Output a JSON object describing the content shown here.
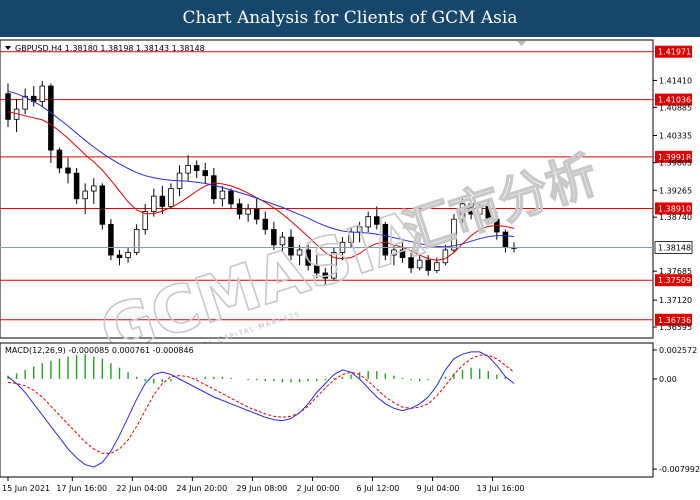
{
  "header": {
    "title": "Chart Analysis for Clients of GCM Asia"
  },
  "main_chart": {
    "symbol_line": "GBPUSD,H4  1.38180 1.38198 1.38143 1.38148",
    "current_price": "1.38148"
  },
  "macd_panel": {
    "label": "MACD(12,26,9) -0.000085 0.000761 -0.000846"
  },
  "watermark": {
    "text": "GCMASIA",
    "subtext": "GLOBAL CAPITAL MARKETS",
    "chinese": "汇市分析"
  },
  "colors": {
    "header_bg": "#16476b",
    "level_line": "#e00000",
    "ma_fast": "#e00000",
    "ma_slow": "#2a2ae0",
    "macd_hist": "#1fa21f",
    "signal_line": "#e00000",
    "macd_line": "#2a2ae0"
  },
  "chart_data": [
    {
      "type": "candlestick",
      "title": "",
      "series": [
        {
          "kind": "candles",
          "values": [
            [
              1.4115,
              1.4135,
              1.405,
              1.4065
            ],
            [
              1.4065,
              1.4105,
              1.404,
              1.4085
            ],
            [
              1.4085,
              1.4125,
              1.4075,
              1.411
            ],
            [
              1.411,
              1.413,
              1.409,
              1.41
            ],
            [
              1.41,
              1.414,
              1.409,
              1.413
            ],
            [
              1.413,
              1.4135,
              1.398,
              1.4005
            ],
            [
              1.4005,
              1.401,
              1.396,
              1.397
            ],
            [
              1.397,
              1.399,
              1.394,
              1.396
            ],
            [
              1.396,
              1.397,
              1.39,
              1.391
            ],
            [
              1.391,
              1.394,
              1.388,
              1.3925
            ],
            [
              1.3925,
              1.395,
              1.39,
              1.3935
            ],
            [
              1.3935,
              1.394,
              1.385,
              1.386
            ],
            [
              1.386,
              1.387,
              1.379,
              1.38
            ],
            [
              1.38,
              1.381,
              1.378,
              1.3795
            ],
            [
              1.3795,
              1.3815,
              1.3785,
              1.3805
            ],
            [
              1.3805,
              1.386,
              1.38,
              1.385
            ],
            [
              1.385,
              1.39,
              1.384,
              1.3885
            ],
            [
              1.3885,
              1.393,
              1.3875,
              1.3915
            ],
            [
              1.3915,
              1.3935,
              1.388,
              1.3895
            ],
            [
              1.3895,
              1.394,
              1.389,
              1.393
            ],
            [
              1.393,
              1.3975,
              1.3915,
              1.396
            ],
            [
              1.396,
              1.3995,
              1.3945,
              1.3975
            ],
            [
              1.3975,
              1.3985,
              1.395,
              1.3965
            ],
            [
              1.3965,
              1.398,
              1.394,
              1.3955
            ],
            [
              1.3955,
              1.397,
              1.39,
              1.391
            ],
            [
              1.391,
              1.3935,
              1.3895,
              1.3925
            ],
            [
              1.3925,
              1.393,
              1.389,
              1.39
            ],
            [
              1.39,
              1.391,
              1.387,
              1.388
            ],
            [
              1.388,
              1.39,
              1.3865,
              1.389
            ],
            [
              1.389,
              1.391,
              1.386,
              1.387
            ],
            [
              1.387,
              1.3885,
              1.384,
              1.385
            ],
            [
              1.385,
              1.3865,
              1.381,
              1.382
            ],
            [
              1.382,
              1.3845,
              1.3805,
              1.3835
            ],
            [
              1.3835,
              1.385,
              1.379,
              1.38
            ],
            [
              1.38,
              1.382,
              1.378,
              1.381
            ],
            [
              1.381,
              1.3825,
              1.377,
              1.378
            ],
            [
              1.378,
              1.38,
              1.3755,
              1.3765
            ],
            [
              1.3765,
              1.3775,
              1.374,
              1.3755
            ],
            [
              1.3755,
              1.3815,
              1.375,
              1.3805
            ],
            [
              1.3805,
              1.3835,
              1.379,
              1.3825
            ],
            [
              1.3825,
              1.3855,
              1.3815,
              1.3845
            ],
            [
              1.3845,
              1.3865,
              1.3825,
              1.3855
            ],
            [
              1.3855,
              1.3885,
              1.3845,
              1.3875
            ],
            [
              1.3875,
              1.3895,
              1.385,
              1.386
            ],
            [
              1.386,
              1.3865,
              1.379,
              1.38
            ],
            [
              1.38,
              1.382,
              1.378,
              1.381
            ],
            [
              1.381,
              1.3825,
              1.3785,
              1.3795
            ],
            [
              1.3795,
              1.381,
              1.3765,
              1.3775
            ],
            [
              1.3775,
              1.38,
              1.377,
              1.379
            ],
            [
              1.379,
              1.38,
              1.376,
              1.377
            ],
            [
              1.377,
              1.3795,
              1.3765,
              1.3785
            ],
            [
              1.3785,
              1.382,
              1.378,
              1.381
            ],
            [
              1.381,
              1.388,
              1.3805,
              1.387
            ],
            [
              1.387,
              1.391,
              1.386,
              1.39
            ],
            [
              1.39,
              1.3905,
              1.387,
              1.388
            ],
            [
              1.388,
              1.3905,
              1.3875,
              1.3895
            ],
            [
              1.3895,
              1.3905,
              1.386,
              1.387
            ],
            [
              1.387,
              1.3885,
              1.383,
              1.3845
            ],
            [
              1.3845,
              1.385,
              1.3805,
              1.3815
            ],
            [
              1.3815,
              1.3825,
              1.3805,
              1.3815
            ]
          ]
        },
        {
          "kind": "ma_fast",
          "values": [
            1.408,
            1.4076,
            1.4072,
            1.4068,
            1.4064,
            1.4055,
            1.4042,
            1.4028,
            1.4012,
            1.3996,
            1.3982,
            1.3966,
            1.3946,
            1.3925,
            1.3904,
            1.3888,
            1.3881,
            1.3881,
            1.3886,
            1.3893,
            1.3902,
            1.3913,
            1.3925,
            1.3935,
            1.3941,
            1.3939,
            1.3935,
            1.3929,
            1.3921,
            1.3912,
            1.3903,
            1.3892,
            1.388,
            1.3866,
            1.3851,
            1.3836,
            1.382,
            1.3805,
            1.3795,
            1.3793,
            1.3795,
            1.3803,
            1.3815,
            1.3823,
            1.3825,
            1.382,
            1.3815,
            1.3808,
            1.38,
            1.3793,
            1.379,
            1.3793,
            1.3805,
            1.3822,
            1.3838,
            1.385,
            1.3856,
            1.3858,
            1.3856,
            1.3852
          ]
        },
        {
          "kind": "ma_slow",
          "values": [
            1.412,
            1.4115,
            1.4108,
            1.41,
            1.409,
            1.4078,
            1.4065,
            1.4052,
            1.4038,
            1.4024,
            1.4011,
            1.3999,
            1.3988,
            1.3978,
            1.3969,
            1.3961,
            1.3955,
            1.3951,
            1.3948,
            1.3946,
            1.3945,
            1.3944,
            1.3942,
            1.394,
            1.3936,
            1.3932,
            1.3927,
            1.3922,
            1.3917,
            1.3911,
            1.3905,
            1.3899,
            1.3893,
            1.3886,
            1.3879,
            1.3872,
            1.3864,
            1.3857,
            1.3851,
            1.3847,
            1.3845,
            1.3844,
            1.3843,
            1.3841,
            1.3838,
            1.3834,
            1.383,
            1.3826,
            1.3822,
            1.3819,
            1.3817,
            1.3816,
            1.3818,
            1.3822,
            1.3827,
            1.3832,
            1.3836,
            1.3838,
            1.3838,
            1.3836
          ]
        }
      ],
      "levels": [
        "1.41971",
        "1.41036",
        "1.39918",
        "1.38910",
        "1.37509",
        "1.36736"
      ],
      "y_ticks": [
        "1.41410",
        "1.40885",
        "1.40335",
        "1.39805",
        "1.39265",
        "1.38740",
        "1.37685",
        "1.37120",
        "1.36595"
      ],
      "ylim": [
        1.364,
        1.4218
      ]
    },
    {
      "type": "macd",
      "title": "",
      "series": [
        {
          "kind": "histogram",
          "values": [
            0.0003,
            0.0005,
            0.0008,
            0.0011,
            0.0014,
            0.0016,
            0.0018,
            0.002,
            0.0021,
            0.0022,
            0.002,
            0.0018,
            0.0014,
            0.001,
            0.0006,
            0.0002,
            -0.0002,
            -0.0004,
            -0.0003,
            -0.0002,
            -0.0001,
            0.0,
            0.0001,
            0.0002,
            0.0002,
            0.0002,
            0.0001,
            0.0,
            -0.0001,
            -0.0001,
            -0.0002,
            -0.0002,
            -0.0003,
            -0.0003,
            -0.0003,
            -0.0002,
            -0.0002,
            -0.0001,
            0.0001,
            0.0002,
            0.0004,
            0.0006,
            0.0007,
            0.0007,
            0.0005,
            0.0003,
            0.0001,
            -0.0001,
            -0.0002,
            -0.0001,
            0.0,
            0.0002,
            0.0005,
            0.0008,
            0.001,
            0.0009,
            0.0007,
            0.0004,
            0.0002,
            0.0
          ]
        },
        {
          "kind": "macd_line",
          "values": [
            0.0002,
            -0.0004,
            -0.0012,
            -0.0022,
            -0.0032,
            -0.0042,
            -0.0052,
            -0.0062,
            -0.007,
            -0.0076,
            -0.0078,
            -0.0074,
            -0.0064,
            -0.005,
            -0.0034,
            -0.0018,
            -0.0004,
            0.0004,
            0.0006,
            0.0004,
            0.0,
            -0.0004,
            -0.0008,
            -0.0012,
            -0.0016,
            -0.0019,
            -0.0022,
            -0.0025,
            -0.0028,
            -0.0031,
            -0.0034,
            -0.0036,
            -0.0037,
            -0.0035,
            -0.003,
            -0.0022,
            -0.0012,
            -0.0004,
            0.0004,
            0.0008,
            0.0006,
            0.0,
            -0.0008,
            -0.0016,
            -0.0022,
            -0.0026,
            -0.0028,
            -0.0026,
            -0.0022,
            -0.0016,
            -0.0006,
            0.0008,
            0.0018,
            0.0022,
            0.0024,
            0.0024,
            0.002,
            0.0012,
            0.0002,
            -0.0004
          ]
        },
        {
          "kind": "signal_line",
          "values": [
            -0.0003,
            -0.0004,
            -0.0006,
            -0.001,
            -0.0016,
            -0.0024,
            -0.0032,
            -0.004,
            -0.0048,
            -0.0056,
            -0.0062,
            -0.0066,
            -0.0066,
            -0.0062,
            -0.0054,
            -0.0042,
            -0.0028,
            -0.0014,
            -0.0004,
            0.0002,
            0.0003,
            0.0002,
            -0.0001,
            -0.0005,
            -0.0009,
            -0.0013,
            -0.0017,
            -0.0021,
            -0.0025,
            -0.0028,
            -0.0031,
            -0.0033,
            -0.0034,
            -0.0033,
            -0.003,
            -0.0024,
            -0.0016,
            -0.0008,
            -0.0001,
            0.0004,
            0.0006,
            0.0004,
            -0.0002,
            -0.0009,
            -0.0016,
            -0.0021,
            -0.0025,
            -0.0026,
            -0.0025,
            -0.0022,
            -0.0015,
            -0.0006,
            0.0004,
            0.0012,
            0.0018,
            0.0021,
            0.0021,
            0.0018,
            0.0012,
            0.0006
          ]
        }
      ],
      "y_ticks": [
        "0.002572",
        "0.00",
        "-0.007992"
      ],
      "ylim": [
        -0.0086,
        0.0031
      ]
    }
  ],
  "x_axis": {
    "labels": [
      "15 Jun 2021",
      "17 Jun 16:00",
      "22 Jun 04:00",
      "24 Jun 20:00",
      "29 Jun 08:00",
      "2 Jul 00:00",
      "6 Jul 12:00",
      "9 Jul 04:00",
      "13 Jul 16:00"
    ],
    "positions": [
      0,
      7.5,
      14.5,
      21.5,
      28.5,
      35.5,
      42.5,
      49.5,
      56.5
    ]
  }
}
